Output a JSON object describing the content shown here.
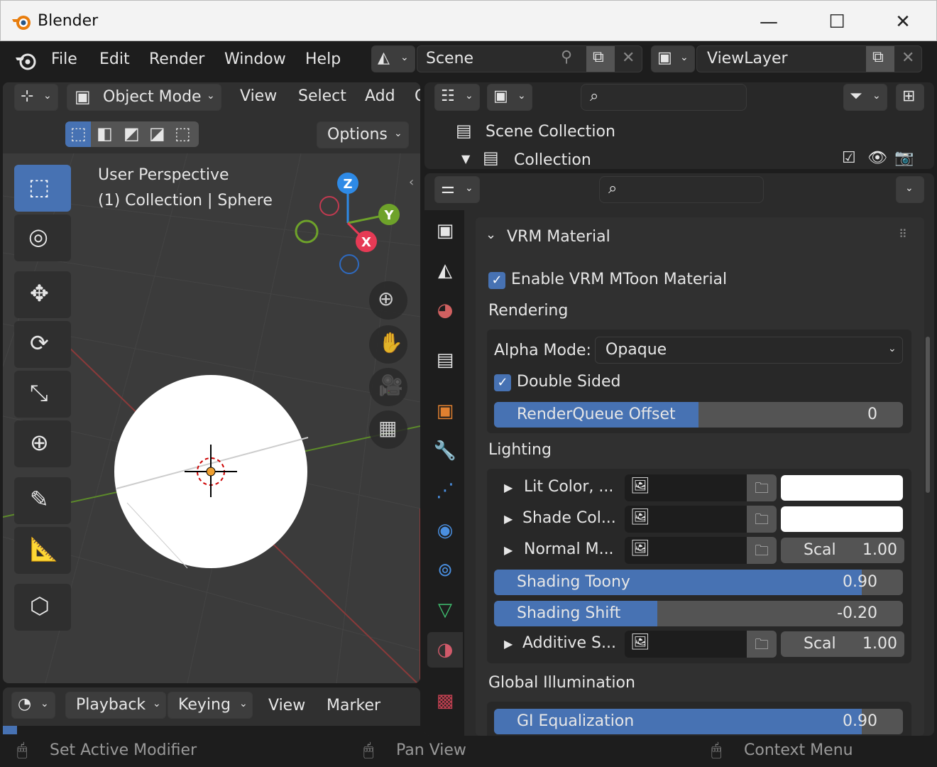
{
  "titlebar": {
    "title": "Blender",
    "minimize": "—",
    "maximize": "☐",
    "close": "✕"
  },
  "menu": {
    "file": "File",
    "edit": "Edit",
    "render": "Render",
    "window": "Window",
    "help": "Help"
  },
  "scene": {
    "name": "Scene",
    "viewlayer": "ViewLayer"
  },
  "viewport": {
    "mode": "Object Mode",
    "menu_view": "View",
    "menu_select": "Select",
    "menu_add": "Add",
    "menu_trunc": "O",
    "options": "Options",
    "overlay_line1": "User Perspective",
    "overlay_line2": "(1) Collection | Sphere",
    "gizmo_z": "Z",
    "gizmo_y": "Y",
    "gizmo_x": "X"
  },
  "timeline": {
    "playback": "Playback",
    "keying": "Keying",
    "view": "View",
    "marker": "Marker"
  },
  "status": {
    "left": "Set Active Modifier",
    "mid": "Pan View",
    "right": "Context Menu"
  },
  "outliner": {
    "scene_collection": "Scene Collection",
    "collection": "Collection"
  },
  "props": {
    "panel_title": "VRM Material",
    "enable_mtoon": "Enable VRM MToon Material",
    "rendering": "Rendering",
    "alpha_mode_label": "Alpha Mode:",
    "alpha_mode_value": "Opaque",
    "double_sided": "Double Sided",
    "render_queue": {
      "label": "RenderQueue Offset",
      "value": "0",
      "fraction": 0.5
    },
    "lighting": "Lighting",
    "lit_color": "Lit Color, ...",
    "shade_color": "Shade Col...",
    "normal_map": "Normal M...",
    "normal_scale_label": "Scal",
    "normal_scale_value": "1.00",
    "shading_toony": {
      "label": "Shading Toony",
      "value": "0.90",
      "fraction": 0.9
    },
    "shading_shift": {
      "label": "Shading Shift",
      "value": "-0.20",
      "fraction": 0.4
    },
    "additive": "Additive S...",
    "additive_scale_label": "Scal",
    "additive_scale_value": "1.00",
    "global_illumination": "Global Illumination",
    "gi_equalization": {
      "label": "GI Equalization",
      "value": "0.90",
      "fraction": 0.9
    }
  },
  "colors": {
    "accent": "#4772b3",
    "bg": "#1d1d1d",
    "panel": "#303030"
  }
}
